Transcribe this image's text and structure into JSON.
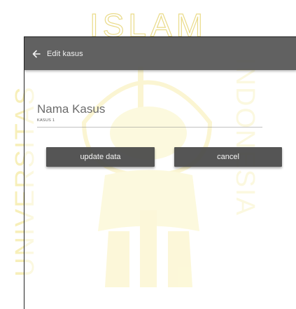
{
  "watermark": {
    "top_text": "ISLAM",
    "left_text": "UNIVERSITAS",
    "right_text": "INDONESIA",
    "color": "#f3e27a"
  },
  "app": {
    "title": "Edit kasus",
    "back_icon": "arrow-left-icon"
  },
  "form": {
    "field_label": "Nama Kasus",
    "field_value": "KASUS 1"
  },
  "buttons": {
    "update_label": "update data",
    "cancel_label": "cancel"
  },
  "colors": {
    "appbar": "#555555",
    "button": "#464646"
  }
}
